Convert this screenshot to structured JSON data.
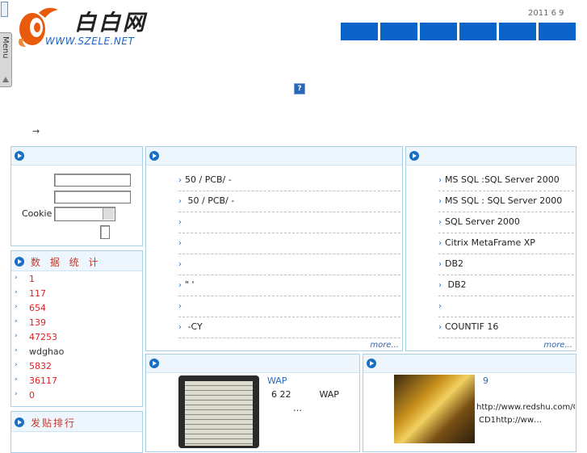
{
  "header": {
    "logo_text": "白白网",
    "logo_url": "WWW.SZELE.NET",
    "menu_tab": "Menu",
    "date": "2011 6 9",
    "nav_buttons": [
      "",
      "",
      "",
      "",
      "",
      ""
    ],
    "help_icon": "?",
    "arrow": "→"
  },
  "colors": {
    "accent": "#0a63c9",
    "panel_border": "#a9cfe6",
    "stat_red": "#e02020"
  },
  "login": {
    "cookie_label": "Cookie"
  },
  "stats": {
    "title": "数 据 统 计",
    "values": [
      "1",
      "117",
      "654",
      "139",
      "47253",
      "wdghao",
      "5832",
      "36117",
      "0"
    ]
  },
  "posts": {
    "title": "发贴排行"
  },
  "middle_news": {
    "items": [
      "50 /     PCB/   -",
      "    50 /     PCB/   -",
      "",
      "",
      "",
      "\" '",
      "",
      "                -CY"
    ],
    "more": "more..."
  },
  "right_news": {
    "items": [
      "MS SQL    :SQL Server 2000",
      "MS SQL    :  SQL Server 2000",
      "SQL Server 2000",
      "Citrix MetaFrame XP",
      "DB2",
      "   DB2",
      "",
      "COUNTIF   16"
    ],
    "more": "more..."
  },
  "wap": {
    "title": "WAP",
    "line1": "6 22          WAP",
    "line2": "…"
  },
  "game": {
    "title": "9",
    "line1": "http://www.redshu.com/C",
    "line2": "CD1http://ww…"
  }
}
